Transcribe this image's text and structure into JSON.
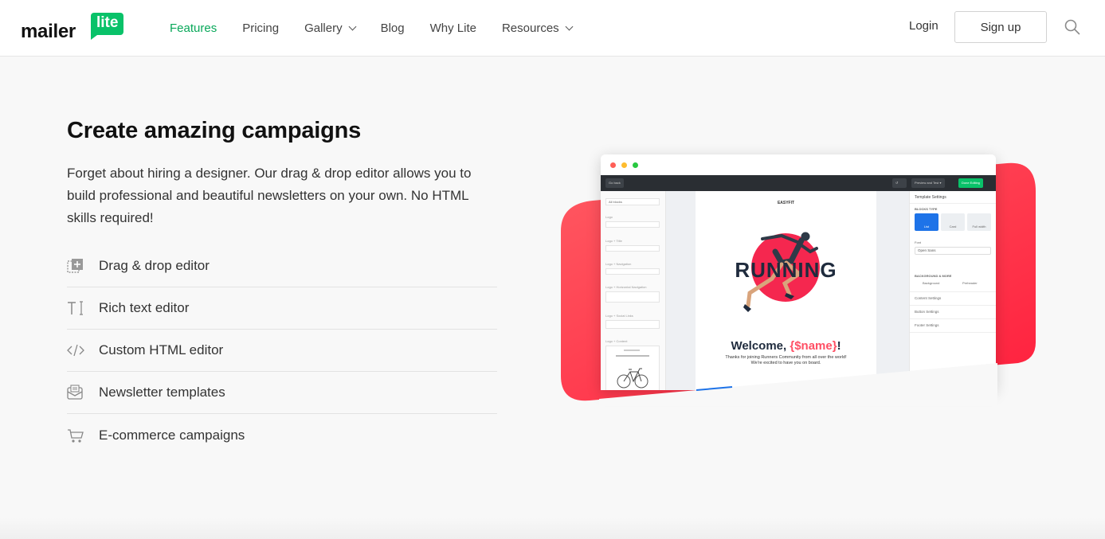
{
  "header": {
    "logo": {
      "word": "mailer",
      "badge": "lite"
    },
    "nav": [
      {
        "label": "Features",
        "active": true,
        "dropdown": false
      },
      {
        "label": "Pricing",
        "active": false,
        "dropdown": false
      },
      {
        "label": "Gallery",
        "active": false,
        "dropdown": true
      },
      {
        "label": "Blog",
        "active": false,
        "dropdown": false
      },
      {
        "label": "Why Lite",
        "active": false,
        "dropdown": false
      },
      {
        "label": "Resources",
        "active": false,
        "dropdown": true
      }
    ],
    "login_label": "Login",
    "signup_label": "Sign up",
    "search_icon": "search-icon"
  },
  "main": {
    "heading": "Create amazing campaigns",
    "description": "Forget about hiring a designer. Our drag & drop editor allows you to build professional and beautiful newsletters on your own. No HTML skills required!",
    "features": [
      {
        "label": "Drag & drop editor",
        "icon": "drag-drop-icon"
      },
      {
        "label": "Rich text editor",
        "icon": "rich-text-icon"
      },
      {
        "label": "Custom HTML editor",
        "icon": "code-icon"
      },
      {
        "label": "Newsletter templates",
        "icon": "newsletter-icon"
      },
      {
        "label": "E-commerce campaigns",
        "icon": "cart-icon"
      }
    ]
  },
  "illustration": {
    "toolbar": {
      "back": "Go back",
      "preview": "Preview and Test ▾",
      "done": "Done Editing"
    },
    "left_panel": {
      "filter": "All blocks",
      "blocks": [
        "Logo",
        "Logo + Title",
        "Logo + Navigation",
        "Logo + Horizontal Navigation",
        "Logo + Social Links",
        "Logo + Content"
      ]
    },
    "email": {
      "brand": "EASYFIT",
      "headline": "RUNNING",
      "welcome_prefix": "Welcome, ",
      "welcome_var": "{$name}",
      "welcome_suffix": "!",
      "body": "Thanks for joining Runners Community from all over the world! We're excited to have you on board."
    },
    "right_panel": {
      "title": "Template Settings",
      "blocks_type": "BLOCKS TYPE",
      "block_options": [
        "List",
        "Card",
        "Full width"
      ],
      "font_label": "Font",
      "font_value": "Open Sans",
      "bg_label": "BACKGROUND & MORE",
      "bg_options": [
        "Background",
        "Preheader"
      ],
      "sections": [
        "Content Settings",
        "Button Settings",
        "Footer Settings"
      ]
    },
    "colors": {
      "red": "#ff3b4e",
      "green": "#09c269",
      "dark": "#2a2e33"
    }
  }
}
